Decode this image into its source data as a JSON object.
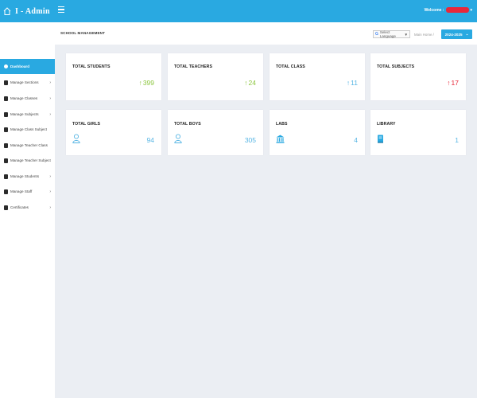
{
  "app": {
    "title": "I - Admin",
    "welcome": "Welcome : "
  },
  "colors": {
    "primary": "#29a9e1",
    "green": "#8cc63f",
    "blue": "#56b5e4",
    "red": "#e8283a"
  },
  "sidebar": {
    "items": [
      {
        "label": "Dashboard",
        "icon": "dashboard-icon",
        "active": true,
        "has_submenu": false
      },
      {
        "label": "Manage Sections",
        "icon": "book-icon",
        "has_submenu": true
      },
      {
        "label": "Manage Classes",
        "icon": "book-icon",
        "has_submenu": true
      },
      {
        "label": "Manage Subjects",
        "icon": "book-icon",
        "has_submenu": true
      },
      {
        "label": "Manage Class Subject",
        "icon": "book-icon",
        "has_submenu": false
      },
      {
        "label": "Manage Teacher Class",
        "icon": "book-icon",
        "has_submenu": false
      },
      {
        "label": "Manage Teacher Subject",
        "icon": "book-icon",
        "has_submenu": false
      },
      {
        "label": "Manage Students",
        "icon": "book-icon",
        "has_submenu": true
      },
      {
        "label": "Manage Staff",
        "icon": "book-icon",
        "has_submenu": true
      },
      {
        "label": "Certificates",
        "icon": "book-icon",
        "has_submenu": true
      }
    ]
  },
  "header": {
    "page_title": "SCHOOL MANAGEMENT",
    "language_label": "Select Language",
    "google_mark": "G",
    "breadcrumb": "Main Home  /",
    "session_year": "2024-2025"
  },
  "stats_top": [
    {
      "label": "TOTAL STUDENTS",
      "value": "399",
      "arrow": "↑",
      "color": "#8cc63f"
    },
    {
      "label": "TOTAL TEACHERS",
      "value": "24",
      "arrow": "↑",
      "color": "#8cc63f"
    },
    {
      "label": "TOTAL CLASS",
      "value": "11",
      "arrow": "↑",
      "color": "#56b5e4"
    },
    {
      "label": "TOTAL SUBJECTS",
      "value": "17",
      "arrow": "↑",
      "color": "#e8283a"
    }
  ],
  "stats_bottom": [
    {
      "label": "TOTAL GIRLS",
      "value": "94",
      "icon": "user-icon"
    },
    {
      "label": "TOTAL BOYS",
      "value": "305",
      "icon": "user-icon"
    },
    {
      "label": "LABS",
      "value": "4",
      "icon": "bank-icon"
    },
    {
      "label": "LIBRARY",
      "value": "1",
      "icon": "book-icon"
    }
  ]
}
